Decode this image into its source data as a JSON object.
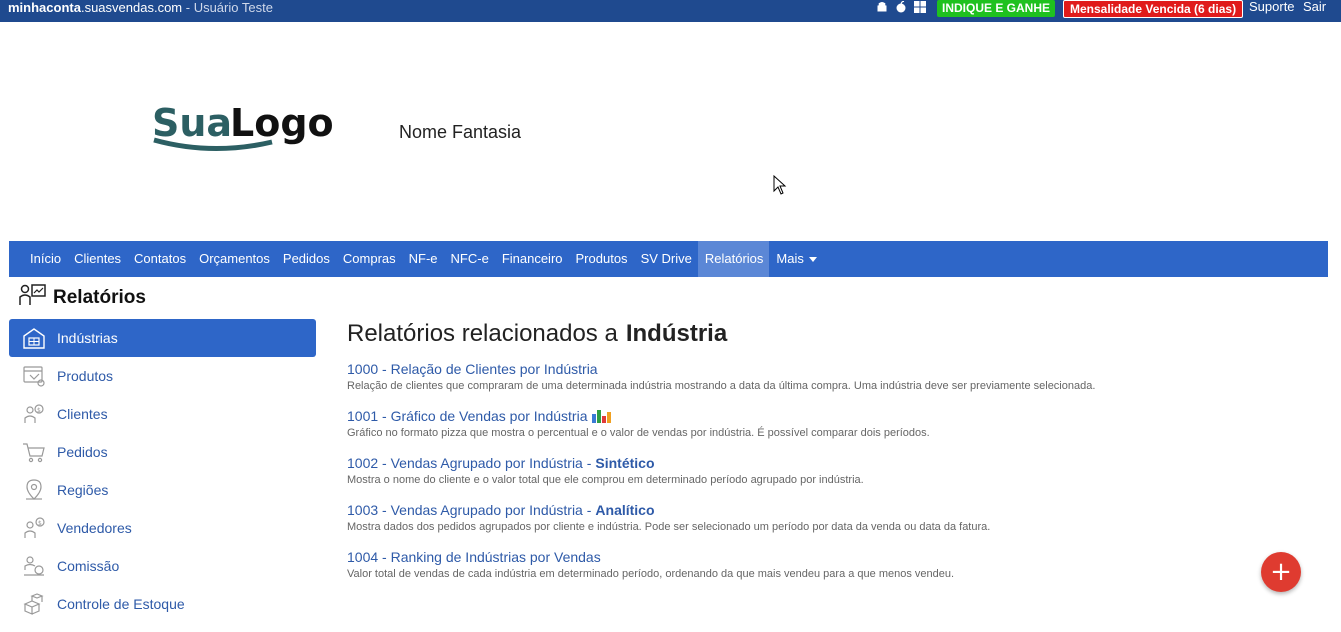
{
  "topbar": {
    "domain_bold": "minhaconta",
    "domain_rest": ".suasvendas.com",
    "user_label": " - Usuário Teste",
    "os_icons": [
      "android-icon",
      "apple-icon",
      "windows-icon"
    ],
    "indique_label": "INDIQUE E GANHE",
    "mensalidade_label": "Mensalidade Vencida (6 dias)",
    "suporte_label": "Suporte",
    "sair_label": "Sair",
    "colors": {
      "bar": "#1f4a8f",
      "indique": "#1fc11f",
      "mensalidade": "#e01b1b"
    }
  },
  "header": {
    "logo_text_1": "Sua",
    "logo_text_2": "Logo",
    "nome_fantasia": "Nome Fantasia"
  },
  "nav": {
    "items": [
      "Início",
      "Clientes",
      "Contatos",
      "Orçamentos",
      "Pedidos",
      "Compras",
      "NF-e",
      "NFC-e",
      "Financeiro",
      "Produtos",
      "SV Drive",
      "Relatórios",
      "Mais"
    ],
    "active": "Relatórios",
    "color": "#2e66c8"
  },
  "page": {
    "title": "Relatórios"
  },
  "sidebar": {
    "items": [
      {
        "label": "Indústrias",
        "icon": "factory-icon"
      },
      {
        "label": "Produtos",
        "icon": "product-icon"
      },
      {
        "label": "Clientes",
        "icon": "clients-icon"
      },
      {
        "label": "Pedidos",
        "icon": "cart-icon"
      },
      {
        "label": "Regiões",
        "icon": "map-pin-icon"
      },
      {
        "label": "Vendedores",
        "icon": "sellers-icon"
      },
      {
        "label": "Comissão",
        "icon": "commission-icon"
      },
      {
        "label": "Controle de Estoque",
        "icon": "stock-icon"
      }
    ],
    "active": "Indústrias"
  },
  "main": {
    "heading_prefix": "Relatórios relacionados a",
    "heading_entity": "Indústria",
    "reports": [
      {
        "title": "1000 - Relação de Clientes por Indústria",
        "suffix": "",
        "description": "Relação de clientes que compraram de uma determinada indústria mostrando a data da última compra. Uma indústria deve ser previamente selecionada."
      },
      {
        "title": "1001 - Gráfico de Vendas por Indústria",
        "suffix": "",
        "description": "Gráfico no formato pizza que mostra o percentual e o valor de vendas por indústria. É possível comparar dois períodos."
      },
      {
        "title": "1002 - Vendas Agrupado por Indústria -",
        "suffix": "Sintético",
        "description": "Mostra o nome do cliente e o valor total que ele comprou em determinado período agrupado por indústria."
      },
      {
        "title": "1003 - Vendas Agrupado por Indústria -",
        "suffix": "Analítico",
        "description": "Mostra dados dos pedidos agrupados por cliente e indústria. Pode ser selecionado um período por data da venda ou data da fatura."
      },
      {
        "title": "1004 - Ranking de Indústrias por Vendas",
        "suffix": "",
        "description": "Valor total de vendas de cada indústria em determinado período, ordenando da que mais vendeu para a que menos vendeu."
      }
    ]
  },
  "fab": {
    "label": "+"
  }
}
